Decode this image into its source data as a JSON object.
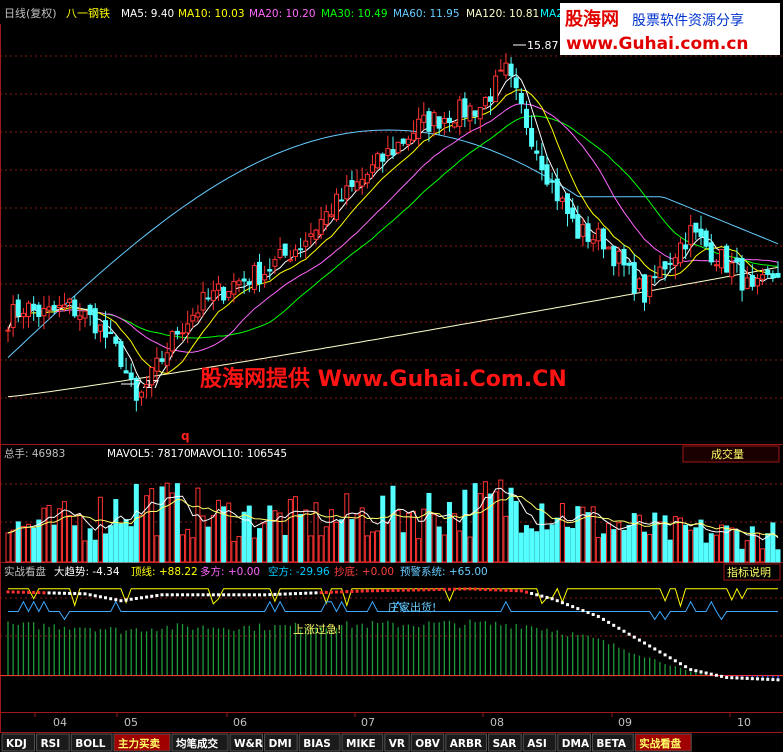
{
  "header": {
    "period": "日线(复权)",
    "stock": "八一钢铁",
    "ma": [
      {
        "label": "MA5: 9.40",
        "color": "#ffffff"
      },
      {
        "label": "MA10: 10.03",
        "color": "#ffff00"
      },
      {
        "label": "MA20: 10.20",
        "color": "#ff66ff"
      },
      {
        "label": "MA30: 10.49",
        "color": "#00ff00"
      },
      {
        "label": "MA60: 11.95",
        "color": "#66ccff"
      },
      {
        "label": "MA120: 10.81",
        "color": "#ffffcc"
      },
      {
        "label": "MA2",
        "color": "#00ffff"
      }
    ]
  },
  "logo": {
    "brand": "股海网",
    "slogan": "股票软件资源分享",
    "url": "www.Guhai.com.cn"
  },
  "watermark": "股海网提供 Www.Guhai.Com.CN",
  "price_high_label": "15.87",
  "price_low_label": "7.17",
  "cursor_mark": "q",
  "volume_panel": {
    "title": "总手: 46983",
    "mavol5": "MAVOL5: 78170",
    "mavol10": "MAVOL10: 106545",
    "badge": "成交量"
  },
  "indicator_panel": {
    "name": "实战看盘",
    "trend": "大趋势: -4.34",
    "top": "顶线: +88.22",
    "long": "多方: +0.00",
    "short": "空方: -29.96",
    "sell": "抄底: +0.00",
    "warn": "预警系统: +65.00",
    "explain": "指标说明",
    "note_dealer": "庄家出货!",
    "note_rise": "上涨过急!"
  },
  "x_axis": [
    "04",
    "05",
    "06",
    "07",
    "08",
    "09",
    "10"
  ],
  "tabs": [
    {
      "label": "KDJ",
      "active": false
    },
    {
      "label": "RSI",
      "active": false
    },
    {
      "label": "BOLL",
      "active": false
    },
    {
      "label": "主力买卖",
      "active": true
    },
    {
      "label": "均笔成交",
      "active": false
    },
    {
      "label": "W&R",
      "active": false
    },
    {
      "label": "DMI",
      "active": false
    },
    {
      "label": "BIAS",
      "active": false
    },
    {
      "label": "MIKE",
      "active": false
    },
    {
      "label": "VR",
      "active": false
    },
    {
      "label": "OBV",
      "active": false
    },
    {
      "label": "ARBR",
      "active": false
    },
    {
      "label": "SAR",
      "active": false
    },
    {
      "label": "ASI",
      "active": false
    },
    {
      "label": "DMA",
      "active": false
    },
    {
      "label": "BETA",
      "active": false
    },
    {
      "label": "实战看盘",
      "active": true
    }
  ],
  "chart_data": {
    "type": "candlestick",
    "price_range": [
      6.5,
      17.0
    ],
    "x_months": [
      "04",
      "05",
      "06",
      "07",
      "08",
      "09",
      "10"
    ],
    "price_path": [
      [
        0,
        9.6
      ],
      [
        3,
        9.9
      ],
      [
        7,
        9.7
      ],
      [
        12,
        9.9
      ],
      [
        17,
        9.5
      ],
      [
        22,
        8.6
      ],
      [
        25,
        7.4
      ],
      [
        28,
        8.1
      ],
      [
        33,
        9.3
      ],
      [
        38,
        10.0
      ],
      [
        44,
        10.5
      ],
      [
        50,
        10.8
      ],
      [
        57,
        11.5
      ],
      [
        63,
        12.4
      ],
      [
        68,
        13.0
      ],
      [
        74,
        13.8
      ],
      [
        80,
        14.5
      ],
      [
        86,
        14.8
      ],
      [
        92,
        15.0
      ],
      [
        97,
        15.87
      ],
      [
        101,
        14.6
      ],
      [
        106,
        13.0
      ],
      [
        111,
        11.8
      ],
      [
        116,
        11.6
      ],
      [
        121,
        10.7
      ],
      [
        124,
        10.2
      ],
      [
        128,
        11.0
      ],
      [
        133,
        11.8
      ],
      [
        138,
        11.2
      ],
      [
        142,
        10.8
      ],
      [
        145,
        10.2
      ],
      [
        150,
        10.8
      ]
    ],
    "volume_range": [
      0,
      260000
    ],
    "volume_profile": [
      [
        0,
        90000
      ],
      [
        15,
        110000
      ],
      [
        25,
        160000
      ],
      [
        40,
        120000
      ],
      [
        60,
        110000
      ],
      [
        75,
        130000
      ],
      [
        90,
        140000
      ],
      [
        100,
        170000
      ],
      [
        115,
        100000
      ],
      [
        130,
        80000
      ],
      [
        150,
        70000
      ]
    ],
    "indicator_range": [
      -35,
      95
    ],
    "trend_path": [
      [
        0,
        85
      ],
      [
        15,
        83
      ],
      [
        22,
        76
      ],
      [
        30,
        82
      ],
      [
        50,
        82
      ],
      [
        70,
        86
      ],
      [
        90,
        88
      ],
      [
        100,
        86
      ],
      [
        106,
        78
      ],
      [
        115,
        60
      ],
      [
        125,
        30
      ],
      [
        133,
        6
      ],
      [
        140,
        -2
      ],
      [
        150,
        -4.34
      ]
    ]
  }
}
